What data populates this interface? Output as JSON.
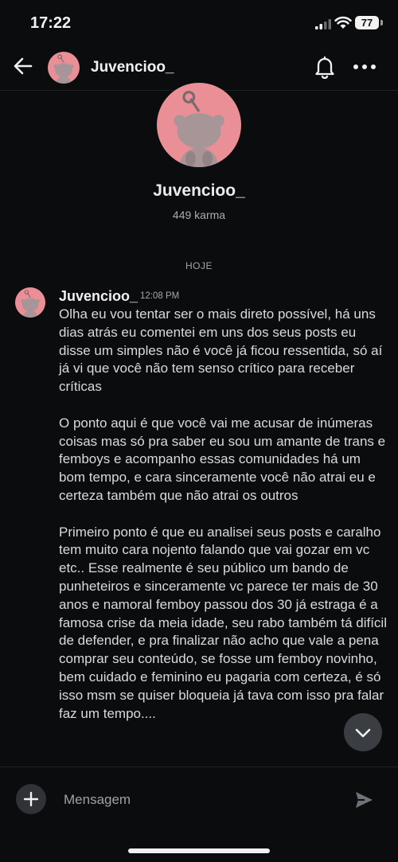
{
  "status_bar": {
    "time": "17:22",
    "battery": "77"
  },
  "header": {
    "username": "Juvencioo_"
  },
  "profile": {
    "username": "Juvencioo_",
    "karma": "449 karma"
  },
  "date_divider": "HOJE",
  "message": {
    "author": "Juvencioo_",
    "time": "12:08 PM",
    "paragraphs": [
      "Olha eu vou tentar ser o mais direto possível, há uns dias atrás eu comentei em uns dos seus posts eu disse um simples não é você já ficou ressentida, só aí já vi que você não tem senso crítico para receber críticas",
      "O ponto aqui é que você vai me acusar de inúmeras coisas mas só pra saber eu sou um amante de trans e femboys e acompanho essas comunidades há um bom tempo, e cara sinceramente você não atrai eu e certeza também que não atrai os outros",
      "Primeiro ponto é que eu analisei seus posts e caralho tem muito cara nojento falando que vai gozar em vc etc.. Esse realmente é seu público um bando de punheteiros e sinceramente vc parece ter mais de 30 anos e namoral femboy passou dos 30 já estraga é a famosa crise da meia idade, seu rabo também tá difícil de defender, e pra finalizar não acho que vale a pena comprar seu conteúdo, se fosse um femboy novinho, bem cuidado e feminino eu pagaria com certeza, é só isso msm se quiser bloqueia já tava com isso pra falar faz um tempo...."
    ]
  },
  "composer": {
    "placeholder": "Mensagem"
  },
  "icons": {
    "back": "arrow-left-icon",
    "notifications": "bell-icon",
    "more": "more-horizontal-icon",
    "add": "plus-icon",
    "send": "send-icon",
    "scroll_down": "chevron-down-icon"
  },
  "colors": {
    "background": "#0b0c0e",
    "avatar_bg": "#eb8f97",
    "text": "#d9dadd"
  }
}
